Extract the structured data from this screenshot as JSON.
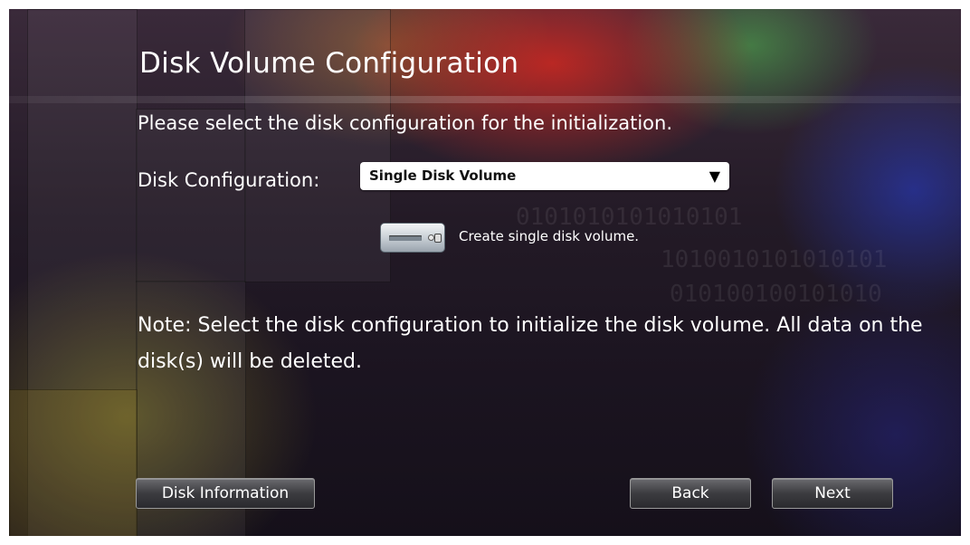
{
  "title": "Disk Volume Configuration",
  "instruction": "Please select the disk configuration for the initialization.",
  "disk_config": {
    "label": "Disk Configuration:",
    "selected": "Single Disk Volume",
    "description": "Create single disk volume."
  },
  "note": "Note: Select the disk configuration to initialize the disk volume.  All data on the disk(s) will be deleted.",
  "buttons": {
    "disk_information": "Disk Information",
    "back": "Back",
    "next": "Next"
  },
  "icons": {
    "dropdown": "dropdown-arrow-icon",
    "disk": "hard-disk-icon"
  }
}
